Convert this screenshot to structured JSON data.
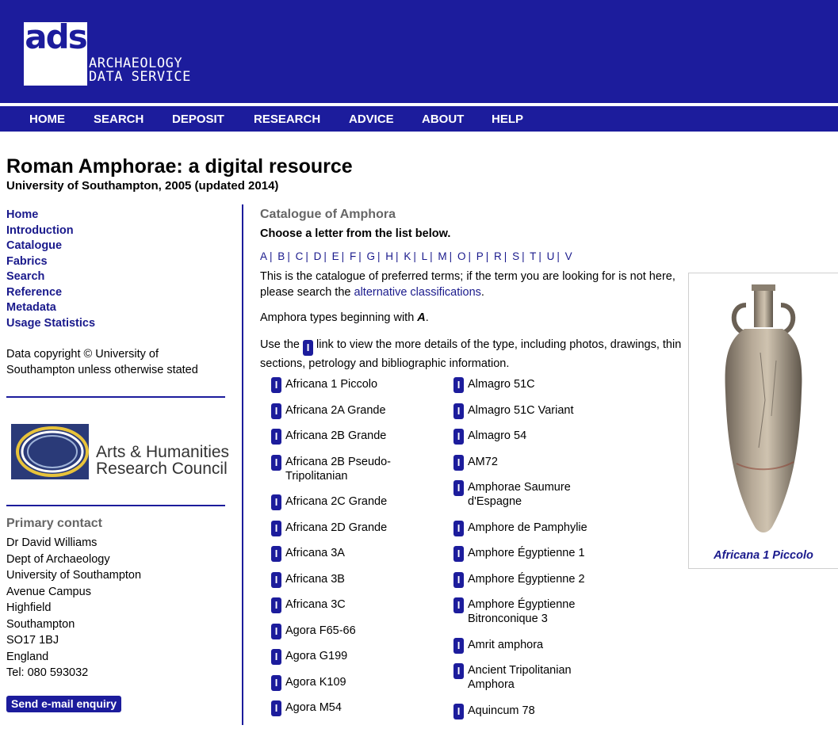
{
  "logo": {
    "abbr": "ads",
    "line1": "ARCHAEOLOGY",
    "line2": "DATA SERVICE"
  },
  "nav": [
    "HOME",
    "SEARCH",
    "DEPOSIT",
    "RESEARCH",
    "ADVICE",
    "ABOUT",
    "HELP"
  ],
  "site": {
    "title": "Roman Amphorae: a digital resource",
    "subtitle": "University of Southampton, 2005 (updated 2014)"
  },
  "sidebar": {
    "links": [
      "Home",
      "Introduction",
      "Catalogue",
      "Fabrics",
      "Search",
      "Reference",
      "Metadata",
      "Usage Statistics"
    ],
    "copyright": "Data copyright © University of Southampton unless otherwise stated",
    "ahrc_line1": "Arts & Humanities",
    "ahrc_line2": "Research Council",
    "contact_heading": "Primary contact",
    "contact_lines": [
      "Dr David Williams",
      "Dept of Archaeology",
      "University of Southampton",
      "Avenue Campus",
      "Highfield",
      "Southampton",
      "SO17 1BJ",
      "England",
      "Tel: 080 593032"
    ],
    "email_button": "Send e-mail enquiry"
  },
  "main": {
    "heading": "Catalogue of Amphora",
    "subheading": "Choose a letter from the list below.",
    "letters": [
      "A",
      "B",
      "C",
      "D",
      "E",
      "F",
      "G",
      "H",
      "K",
      "L",
      "M",
      "O",
      "P",
      "R",
      "S",
      "T",
      "U",
      "V"
    ],
    "intro_text": "This is the catalogue of preferred terms; if the term you are looking for is not here, please search the ",
    "intro_link": "alternative classifications",
    "begin_prefix": "Amphora types beginning with ",
    "begin_letter": "A",
    "use_prefix": "Use the ",
    "info_glyph": "I",
    "use_suffix": " link to view the more details of the type, including photos, drawings, thin sections, petrology and bibliographic information.",
    "col1": [
      "Africana 1 Piccolo",
      "Africana 2A Grande",
      "Africana 2B Grande",
      "Africana 2B Pseudo-Tripolitanian",
      "Africana 2C Grande",
      "Africana 2D Grande",
      "Africana 3A",
      "Africana 3B",
      "Africana 3C",
      "Agora F65-66",
      "Agora G199",
      "Agora K109",
      "Agora M54"
    ],
    "col2": [
      "Almagro 51C",
      "Almagro 51C Variant",
      "Almagro 54",
      "AM72",
      "Amphorae Saumure d'Espagne",
      "Amphore de Pamphylie",
      "Amphore Égyptienne 1",
      "Amphore Égyptienne 2",
      "Amphore Égyptienne Bitronconique 3",
      "Amrit amphora",
      "Ancient Tripolitanian Amphora",
      "Aquincum 78"
    ]
  },
  "photo": {
    "caption": "Africana 1 Piccolo"
  },
  "colors": {
    "brand_blue": "#1c1c9c",
    "link": "#1a1a8c",
    "heading_grey": "#666666"
  }
}
